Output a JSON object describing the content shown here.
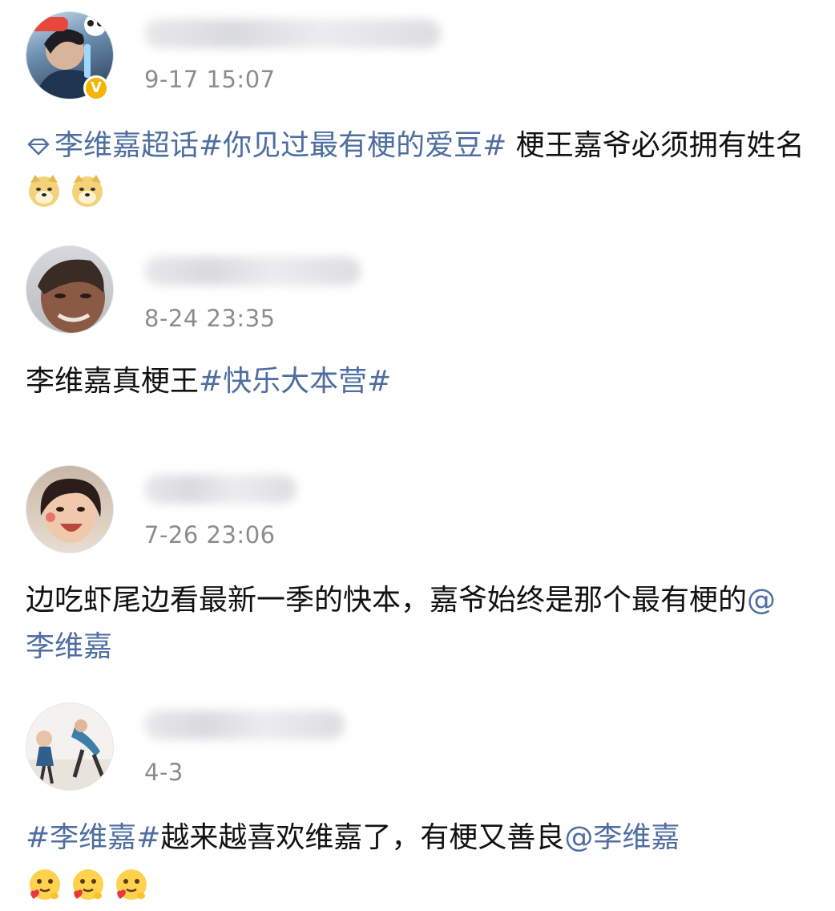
{
  "posts": [
    {
      "time": "9-17 15:07",
      "topic_prefix": "李维嘉超话",
      "hashtag": "#你见过最有梗的爱豆#",
      "text_a": " 梗王嘉爷必须拥有姓名",
      "emoji_name": "doge-emoji",
      "verified_badge": "V"
    },
    {
      "time": "8-24 23:35",
      "text_a": "李维嘉真梗王",
      "hashtag": "#快乐大本营#"
    },
    {
      "time": "7-26 23:06",
      "text_a": "边吃虾尾边看最新一季的快本，嘉爷始终是那个最有梗的",
      "mention": "@李维嘉"
    },
    {
      "time": "4-3",
      "hashtag": "#李维嘉#",
      "text_a": "越来越喜欢维嘉了，有梗又善良",
      "mention": "@李维嘉",
      "emoji_name": "heart-hug-emoji"
    }
  ],
  "colors": {
    "link": "#4e6ea1",
    "timestamp": "#8c8c8c",
    "verified": "#f5b400"
  }
}
